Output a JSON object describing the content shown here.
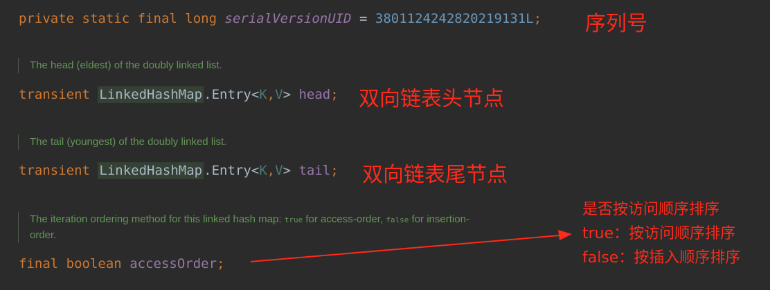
{
  "line1": {
    "kw1": "private",
    "kw2": "static",
    "kw3": "final",
    "kw4": "long",
    "field": "serialVersionUID",
    "eq": "=",
    "value": "3801124242820219131L",
    "semi": ";"
  },
  "note1": "序列号",
  "doc1": "The head (eldest) of the doubly linked list.",
  "line2": {
    "kw": "transient",
    "cls": "LinkedHashMap",
    "rest": ".Entry<",
    "k": "K",
    "comma": ",",
    "v": "V",
    "gt": ">",
    "field": "head",
    "semi": ";"
  },
  "note2": "双向链表头节点",
  "doc2": "The tail (youngest) of the doubly linked list.",
  "line3": {
    "kw": "transient",
    "cls": "LinkedHashMap",
    "rest": ".Entry<",
    "k": "K",
    "comma": ",",
    "v": "V",
    "gt": ">",
    "field": "tail",
    "semi": ";"
  },
  "note3": "双向链表尾节点",
  "doc3": {
    "part1": "The iteration ordering method for this linked hash map: ",
    "code1": "true",
    "part2": " for access-order, ",
    "code2": "false",
    "part3": " for insertion-",
    "part4": "order."
  },
  "line4": {
    "kw1": "final",
    "kw2": "boolean",
    "field": "accessOrder",
    "semi": ";"
  },
  "note4": {
    "l1": "是否按访问顺序排序",
    "l2": "true：按访问顺序排序",
    "l3": "false：按插入顺序排序"
  },
  "colors": {
    "annotation": "#ff2a1a",
    "background": "#2b2b2b"
  }
}
